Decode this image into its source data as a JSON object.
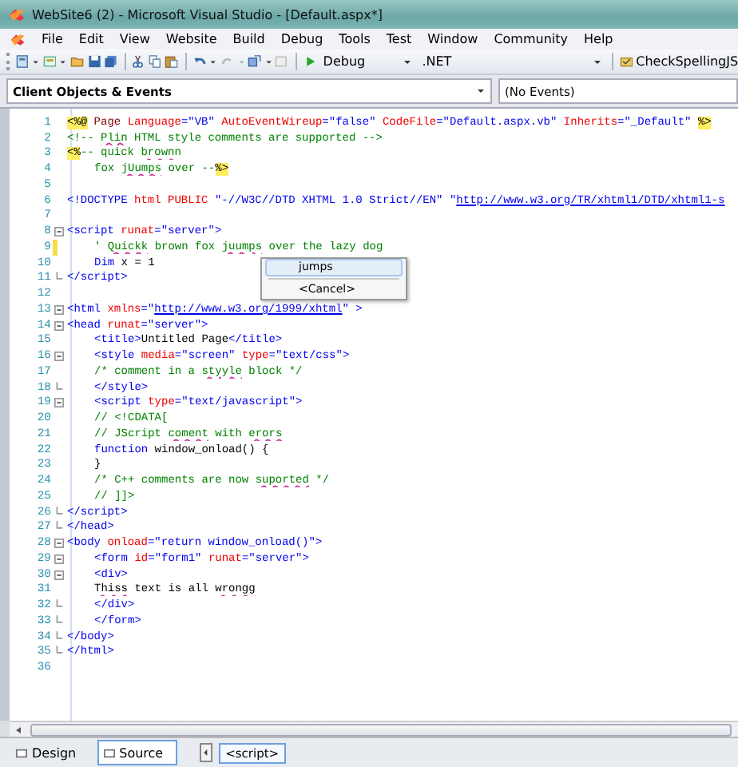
{
  "window": {
    "title": "WebSite6 (2) - Microsoft Visual Studio - [Default.aspx*]"
  },
  "menu": [
    "File",
    "Edit",
    "View",
    "Website",
    "Build",
    "Debug",
    "Tools",
    "Test",
    "Window",
    "Community",
    "Help"
  ],
  "toolbar": {
    "configuration": "Debug",
    "platform": ".NET",
    "addin": "CheckSpellingJS"
  },
  "navigation": {
    "objects": "Client Objects & Events",
    "events": "(No Events)"
  },
  "code_lines": [
    {
      "number": "1",
      "tokens": [
        {
          "kind": "delimiter",
          "text": "<%@"
        },
        {
          "kind": "directive",
          "text": " Page "
        },
        {
          "kind": "attribute",
          "text": "Language"
        },
        {
          "kind": "value",
          "text": "=\"VB\" "
        },
        {
          "kind": "attribute",
          "text": "AutoEventWireup"
        },
        {
          "kind": "value",
          "text": "=\"false\" "
        },
        {
          "kind": "attribute",
          "text": "CodeFile"
        },
        {
          "kind": "value",
          "text": "=\"Default.aspx.vb\" "
        },
        {
          "kind": "attribute",
          "text": "Inherits"
        },
        {
          "kind": "value",
          "text": "=\"_Default\" "
        },
        {
          "kind": "delimiter",
          "text": "%>"
        }
      ]
    },
    {
      "number": "2",
      "tokens": [
        {
          "kind": "comment",
          "text": "<!-- "
        },
        {
          "kind": "comment",
          "text": "Plin",
          "misspelled": true
        },
        {
          "kind": "comment",
          "text": " HTML style comments are supported -->"
        }
      ]
    },
    {
      "number": "3",
      "tokens": [
        {
          "kind": "delimiter",
          "text": "<%"
        },
        {
          "kind": "comment",
          "text": "-- quick "
        },
        {
          "kind": "comment",
          "text": "brownn",
          "misspelled": true
        }
      ]
    },
    {
      "number": "4",
      "indent": true,
      "tokens": [
        {
          "kind": "comment",
          "text": "fox "
        },
        {
          "kind": "comment",
          "text": "jUumps",
          "misspelled": true
        },
        {
          "kind": "comment",
          "text": " over --"
        },
        {
          "kind": "delimiter",
          "text": "%>"
        }
      ]
    },
    {
      "number": "5"
    },
    {
      "number": "6",
      "tokens": [
        {
          "kind": "tag",
          "text": "<!DOCTYPE "
        },
        {
          "kind": "attribute",
          "text": "html PUBLIC "
        },
        {
          "kind": "value",
          "text": "\"-//W3C//DTD XHTML 1.0 Strict//EN\" \""
        },
        {
          "kind": "link",
          "text": "http://www.w3.org/TR/xhtml1/DTD/xhtml1-s"
        }
      ]
    },
    {
      "number": "7"
    },
    {
      "number": "8",
      "collapsible": true,
      "tokens": [
        {
          "kind": "tag",
          "text": "<script "
        },
        {
          "kind": "attribute",
          "text": "runat"
        },
        {
          "kind": "value",
          "text": "=\"server\""
        },
        {
          "kind": "tag",
          "text": ">"
        }
      ]
    },
    {
      "number": "9",
      "indent": true,
      "changed": true,
      "tokens": [
        {
          "kind": "comment",
          "text": "' "
        },
        {
          "kind": "comment",
          "text": "Quickk",
          "misspelled": true
        },
        {
          "kind": "comment",
          "text": " brown fox "
        },
        {
          "kind": "comment",
          "text": "juumps",
          "misspelled": true
        },
        {
          "kind": "comment",
          "text": " over the lazy dog"
        }
      ]
    },
    {
      "number": "10",
      "indent": true,
      "tokens": [
        {
          "kind": "keyword",
          "text": "Dim"
        },
        {
          "kind": "text",
          "text": " x = 1"
        }
      ]
    },
    {
      "number": "11",
      "block_end": true,
      "tokens": [
        {
          "kind": "tag",
          "text": "</script>"
        }
      ]
    },
    {
      "number": "12"
    },
    {
      "number": "13",
      "collapsible": true,
      "tokens": [
        {
          "kind": "tag",
          "text": "<html "
        },
        {
          "kind": "attribute",
          "text": "xmlns"
        },
        {
          "kind": "value",
          "text": "=\""
        },
        {
          "kind": "link",
          "text": "http://www.w3.org/1999/xhtml"
        },
        {
          "kind": "value",
          "text": "\" "
        },
        {
          "kind": "tag",
          "text": ">"
        }
      ]
    },
    {
      "number": "14",
      "collapsible": true,
      "tokens": [
        {
          "kind": "tag",
          "text": "<head "
        },
        {
          "kind": "attribute",
          "text": "runat"
        },
        {
          "kind": "value",
          "text": "=\"server\""
        },
        {
          "kind": "tag",
          "text": ">"
        }
      ]
    },
    {
      "number": "15",
      "indent": true,
      "tokens": [
        {
          "kind": "tag",
          "text": "<title>"
        },
        {
          "kind": "text",
          "text": "Untitled Page"
        },
        {
          "kind": "tag",
          "text": "</title>"
        }
      ]
    },
    {
      "number": "16",
      "indent": true,
      "collapsible": true,
      "tokens": [
        {
          "kind": "tag",
          "text": "<style "
        },
        {
          "kind": "attribute",
          "text": "media"
        },
        {
          "kind": "value",
          "text": "=\"screen\" "
        },
        {
          "kind": "attribute",
          "text": "type"
        },
        {
          "kind": "value",
          "text": "=\"text/css\""
        },
        {
          "kind": "tag",
          "text": ">"
        }
      ]
    },
    {
      "number": "17",
      "indent": true,
      "tokens": [
        {
          "kind": "comment",
          "text": "/* comment in a "
        },
        {
          "kind": "comment",
          "text": "styyle",
          "misspelled": true
        },
        {
          "kind": "comment",
          "text": " block */"
        }
      ]
    },
    {
      "number": "18",
      "indent": true,
      "block_end": true,
      "tokens": [
        {
          "kind": "tag",
          "text": "</style>"
        }
      ]
    },
    {
      "number": "19",
      "indent": true,
      "collapsible": true,
      "tokens": [
        {
          "kind": "tag",
          "text": "<script "
        },
        {
          "kind": "attribute",
          "text": "type"
        },
        {
          "kind": "value",
          "text": "=\"text/javascript\""
        },
        {
          "kind": "tag",
          "text": ">"
        }
      ]
    },
    {
      "number": "20",
      "indent": true,
      "tokens": [
        {
          "kind": "comment",
          "text": "// <!CDATA["
        }
      ]
    },
    {
      "number": "21",
      "indent": true,
      "tokens": [
        {
          "kind": "comment",
          "text": "// JScript "
        },
        {
          "kind": "comment",
          "text": "coment",
          "misspelled": true
        },
        {
          "kind": "comment",
          "text": " with "
        },
        {
          "kind": "comment",
          "text": "erors",
          "misspelled": true
        }
      ]
    },
    {
      "number": "22",
      "indent": true,
      "tokens": [
        {
          "kind": "keyword",
          "text": "function"
        },
        {
          "kind": "text",
          "text": " window_onload() {"
        }
      ]
    },
    {
      "number": "23",
      "indent": true,
      "tokens": [
        {
          "kind": "text",
          "text": "}"
        }
      ]
    },
    {
      "number": "24",
      "indent": true,
      "tokens": [
        {
          "kind": "comment",
          "text": "/* C++ comments are now "
        },
        {
          "kind": "comment",
          "text": "suported",
          "misspelled": true
        },
        {
          "kind": "comment",
          "text": " */"
        }
      ]
    },
    {
      "number": "25",
      "indent": true,
      "tokens": [
        {
          "kind": "comment",
          "text": "// ]]>"
        }
      ]
    },
    {
      "number": "26",
      "block_end": true,
      "tokens": [
        {
          "kind": "tag",
          "text": "</script>"
        }
      ]
    },
    {
      "number": "27",
      "block_end": true,
      "tokens": [
        {
          "kind": "tag",
          "text": "</head>"
        }
      ]
    },
    {
      "number": "28",
      "collapsible": true,
      "tokens": [
        {
          "kind": "tag",
          "text": "<body "
        },
        {
          "kind": "attribute",
          "text": "onload"
        },
        {
          "kind": "value",
          "text": "=\"return window_onload()\""
        },
        {
          "kind": "tag",
          "text": ">"
        }
      ]
    },
    {
      "number": "29",
      "indent": true,
      "collapsible": true,
      "tokens": [
        {
          "kind": "tag",
          "text": "<form "
        },
        {
          "kind": "attribute",
          "text": "id"
        },
        {
          "kind": "value",
          "text": "=\"form1\" "
        },
        {
          "kind": "attribute",
          "text": "runat"
        },
        {
          "kind": "value",
          "text": "=\"server\""
        },
        {
          "kind": "tag",
          "text": ">"
        }
      ]
    },
    {
      "number": "30",
      "indent": true,
      "collapsible": true,
      "tokens": [
        {
          "kind": "tag",
          "text": "<div>"
        }
      ]
    },
    {
      "number": "31",
      "indent": true,
      "tokens": [
        {
          "kind": "text",
          "text": "Thiss",
          "misspelled": true
        },
        {
          "kind": "text",
          "text": " text is all "
        },
        {
          "kind": "text",
          "text": "wrongg",
          "misspelled": true
        }
      ]
    },
    {
      "number": "32",
      "indent": true,
      "block_end": true,
      "tokens": [
        {
          "kind": "tag",
          "text": "</div>"
        }
      ]
    },
    {
      "number": "33",
      "indent": true,
      "block_end": true,
      "tokens": [
        {
          "kind": "tag",
          "text": "</form>"
        }
      ]
    },
    {
      "number": "34",
      "block_end": true,
      "tokens": [
        {
          "kind": "tag",
          "text": "</body>"
        }
      ]
    },
    {
      "number": "35",
      "block_end": true,
      "tokens": [
        {
          "kind": "tag",
          "text": "</html>"
        }
      ]
    },
    {
      "number": "36"
    }
  ],
  "suggestion_menu": [
    {
      "label": "jumps",
      "selected": true
    },
    {
      "label": "<Cancel>",
      "selected": false
    }
  ],
  "view_tabs": [
    {
      "label": "Design",
      "selected": false
    },
    {
      "label": "Source",
      "selected": true
    }
  ],
  "breadcrumb": [
    "<script>"
  ]
}
